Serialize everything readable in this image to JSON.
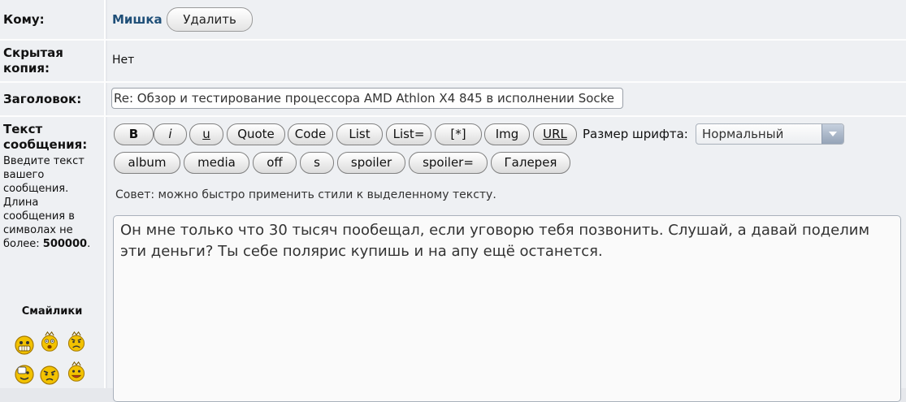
{
  "to": {
    "label": "Кому:",
    "recipient": "Мишка",
    "remove_label": "Удалить"
  },
  "bcc": {
    "label": "Скрытая копия:",
    "value": "Нет"
  },
  "subject": {
    "label": "Заголовок:",
    "value": "Re: Обзор и тестирование процессора AMD Athlon X4 845 в исполнении Socke"
  },
  "message": {
    "label": "Текст сообщения:",
    "hint_prefix": "Введите текст вашего сообщения. Длина сообщения в символах не более:",
    "max_length": "500000",
    "hint_suffix": ".",
    "body": "Он мне только что 30 тысяч пообещал, если уговорю тебя позвонить. Слушай, а давай поделим эти деньги? Ты себе полярис купишь и на апу ещё останется.",
    "tip": "Совет: можно быстро применить стили к выделенному тексту."
  },
  "toolbar": {
    "row1": [
      "B",
      "i",
      "u",
      "Quote",
      "Code",
      "List",
      "List=",
      "[*]",
      "Img",
      "URL"
    ],
    "row2": [
      "album",
      "media",
      "off",
      "s",
      "spoiler",
      "spoiler=",
      "Галерея"
    ],
    "font_size_label": "Размер шрифта:",
    "font_size_value": "Нормальный"
  },
  "smilies": {
    "title": "Смайлики"
  },
  "colors": {
    "link": "#1f4f78",
    "smiley": "#f2c200"
  }
}
